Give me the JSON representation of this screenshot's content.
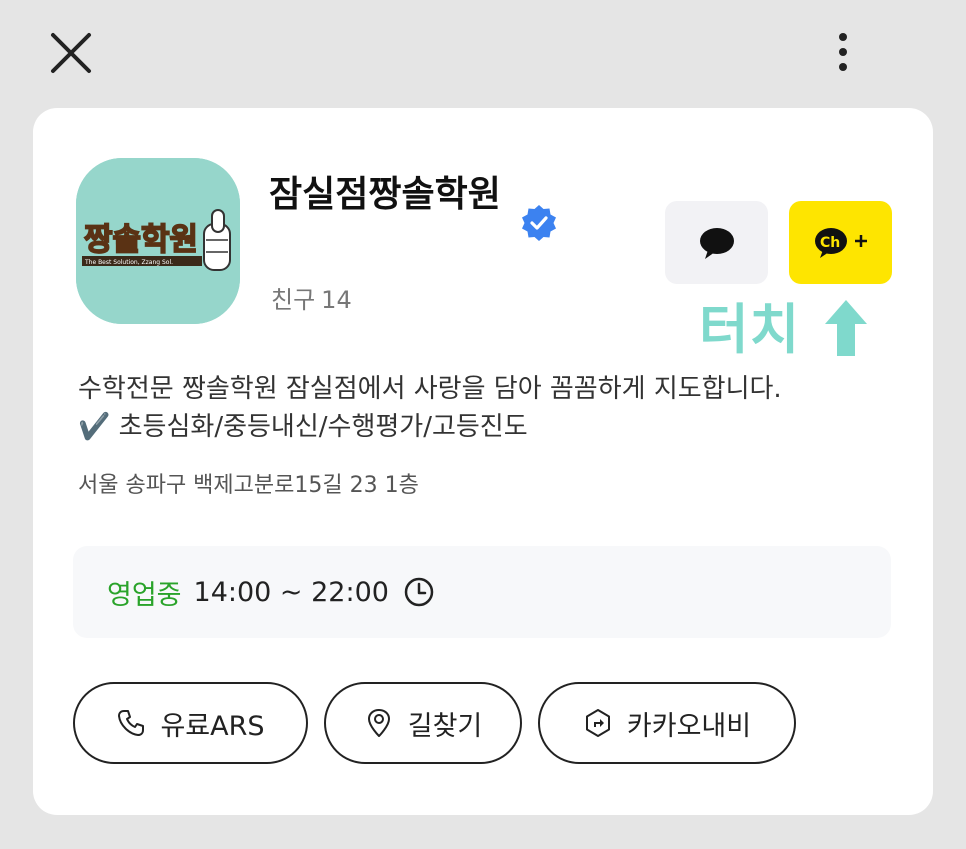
{
  "topbar": {
    "close_icon": "close-icon",
    "more_icon": "more-vertical-icon"
  },
  "profile": {
    "logo_text": "짱솔학원",
    "logo_subtext": "The Best Solution, Zzang Sol.",
    "name": "잠실점짱솔학원",
    "verified_icon": "verified-badge-icon",
    "friends_label": "친구",
    "friends_count": "14"
  },
  "actions": {
    "chat_icon": "chat-bubble-icon",
    "add_channel_icon": "channel-add-icon",
    "add_channel_label": "Ch+"
  },
  "annotation": {
    "text": "터치",
    "arrow_icon": "up-arrow-icon",
    "color": "#7fd9cc"
  },
  "description": {
    "line1": "수학전문 짱솔학원 잠실점에서 사랑을 담아 꼼꼼하게 지도합니다.",
    "line2": "✔️ 초등심화/중등내신/수행평가/고등진도"
  },
  "address": "서울 송파구 백제고분로15길 23 1층",
  "hours": {
    "status": "영업중",
    "time": "14:00 ~ 22:00",
    "status_color": "#2aa32a"
  },
  "buttons": [
    {
      "label": "유료ARS",
      "icon": "phone-icon"
    },
    {
      "label": "길찾기",
      "icon": "location-pin-icon"
    },
    {
      "label": "카카오내비",
      "icon": "navigation-icon"
    }
  ],
  "colors": {
    "background": "#e5e5e5",
    "card": "#ffffff",
    "kakao_yellow": "#fee500",
    "verified_blue": "#3c82f0"
  }
}
